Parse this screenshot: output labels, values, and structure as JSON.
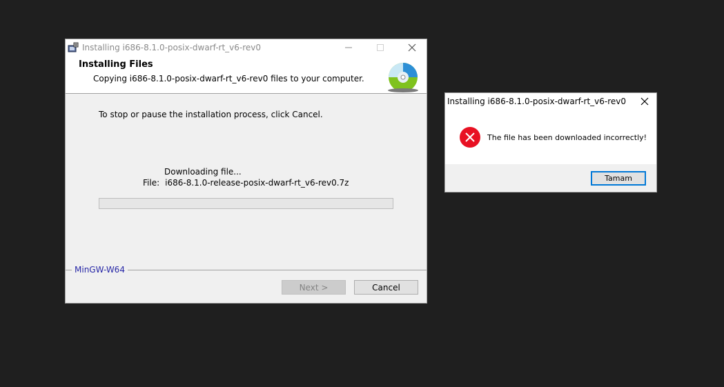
{
  "installer": {
    "title": "Installing i686-8.1.0-posix-dwarf-rt_v6-rev0",
    "header_title": "Installing Files",
    "header_subtitle": "Copying i686-8.1.0-posix-dwarf-rt_v6-rev0 files to your computer.",
    "stop_text": "To stop or pause the installation process, click Cancel.",
    "status_text": "Downloading file...",
    "file_label": "File:",
    "file_name": "i686-8.1.0-release-posix-dwarf-rt_v6-rev0.7z",
    "progress_fraction": 0,
    "brand": "MinGW-W64",
    "next_label": "Next >",
    "cancel_label": "Cancel"
  },
  "dialog": {
    "title": "Installing i686-8.1.0-posix-dwarf-rt_v6-rev0",
    "message": "The file has been downloaded incorrectly!",
    "ok_label": "Tamam"
  },
  "colors": {
    "desktop": "#1f1f1f",
    "error_red": "#e81123",
    "brand_blue": "#2626a6",
    "focus_blue": "#0078d7"
  },
  "icons": [
    "installer-app-icon",
    "minimize-icon",
    "maximize-icon",
    "close-icon",
    "disc-icon",
    "error-icon"
  ]
}
